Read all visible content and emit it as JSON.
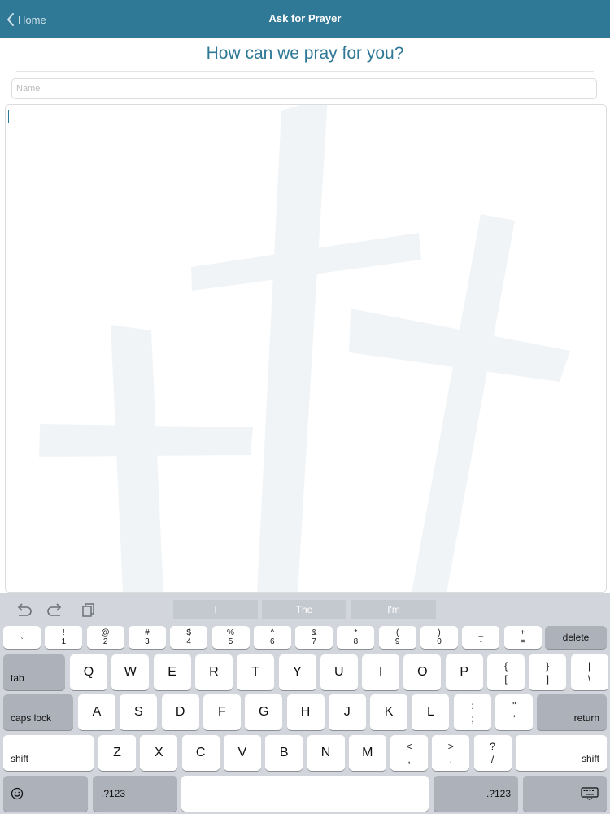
{
  "nav": {
    "back_label": "Home",
    "title": "Ask for Prayer",
    "bar_color": "#2f7896"
  },
  "form": {
    "heading": "How can we pray for you?",
    "name_placeholder": "Name",
    "message_value": ""
  },
  "keyboard": {
    "toolbar_icons": [
      "undo-icon",
      "redo-icon",
      "paste-icon"
    ],
    "suggestions": [
      "I",
      "The",
      "I'm"
    ],
    "number_row": [
      {
        "top": "~",
        "bottom": "`"
      },
      {
        "top": "!",
        "bottom": "1"
      },
      {
        "top": "@",
        "bottom": "2"
      },
      {
        "top": "#",
        "bottom": "3"
      },
      {
        "top": "$",
        "bottom": "4"
      },
      {
        "top": "%",
        "bottom": "5"
      },
      {
        "top": "^",
        "bottom": "6"
      },
      {
        "top": "&",
        "bottom": "7"
      },
      {
        "top": "*",
        "bottom": "8"
      },
      {
        "top": "(",
        "bottom": "9"
      },
      {
        "top": ")",
        "bottom": "0"
      },
      {
        "top": "_",
        "bottom": "-"
      },
      {
        "top": "+",
        "bottom": "="
      }
    ],
    "delete_label": "delete",
    "tab_label": "tab",
    "row_q": [
      "Q",
      "W",
      "E",
      "R",
      "T",
      "Y",
      "U",
      "I",
      "O",
      "P"
    ],
    "row_q_symbols": [
      {
        "top": "{",
        "bottom": "["
      },
      {
        "top": "}",
        "bottom": "]"
      },
      {
        "top": "|",
        "bottom": "\\"
      }
    ],
    "caps_label": "caps lock",
    "row_a": [
      "A",
      "S",
      "D",
      "F",
      "G",
      "H",
      "J",
      "K",
      "L"
    ],
    "row_a_symbols": [
      {
        "top": ":",
        "bottom": ";"
      },
      {
        "top": "\"",
        "bottom": "'"
      }
    ],
    "return_label": "return",
    "shift_label": "shift",
    "row_z": [
      "Z",
      "X",
      "C",
      "V",
      "B",
      "N",
      "M"
    ],
    "row_z_symbols": [
      {
        "top": "<",
        "bottom": ","
      },
      {
        "top": ">",
        "bottom": "."
      },
      {
        "top": "?",
        "bottom": "/"
      }
    ],
    "numbers_label": ".?123"
  }
}
